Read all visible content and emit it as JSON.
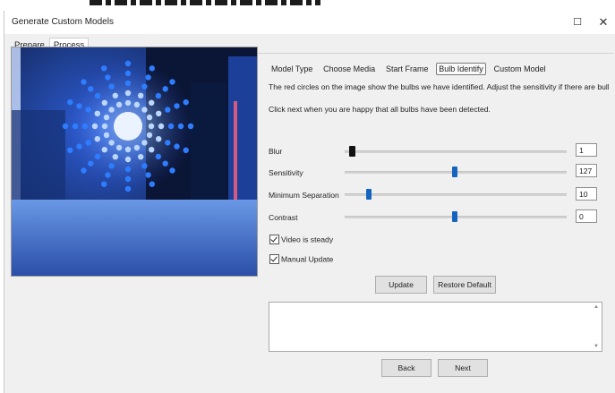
{
  "window": {
    "title": "Generate Custom Models",
    "maximize_glyph": "☐",
    "close_glyph": "✕"
  },
  "tabs": [
    {
      "label": "Prepare",
      "active": false
    },
    {
      "label": "Process",
      "active": true
    }
  ],
  "steps": [
    {
      "label": "Model Type",
      "active": false
    },
    {
      "label": "Choose Media",
      "active": false
    },
    {
      "label": "Start Frame",
      "active": false
    },
    {
      "label": "Bulb Identify",
      "active": true
    },
    {
      "label": "Custom Model",
      "active": false
    }
  ],
  "instructions": {
    "line1": "The red circles on the image show the bulbs we have identified. Adjust the sensitivity if there are bulbs n",
    "line2": "Click next when you are happy that all bulbs have been detected."
  },
  "sliders": {
    "blur": {
      "label": "Blur",
      "value": "1",
      "level": 0.02
    },
    "sensitivity": {
      "label": "Sensitivity",
      "value": "127",
      "level": 0.5
    },
    "min_separation": {
      "label": "Minimum Separation",
      "value": "10",
      "level": 0.1
    },
    "contrast": {
      "label": "Contrast",
      "value": "0",
      "level": 0.5
    }
  },
  "checkboxes": {
    "video_steady": {
      "label": "Video is steady",
      "checked": true
    },
    "manual_update": {
      "label": "Manual Update",
      "checked": true
    }
  },
  "buttons": {
    "update": "Update",
    "restore_default": "Restore Default",
    "back": "Back",
    "next": "Next"
  },
  "colors": {
    "accent": "#1565c0",
    "led": "#2f7dff"
  }
}
